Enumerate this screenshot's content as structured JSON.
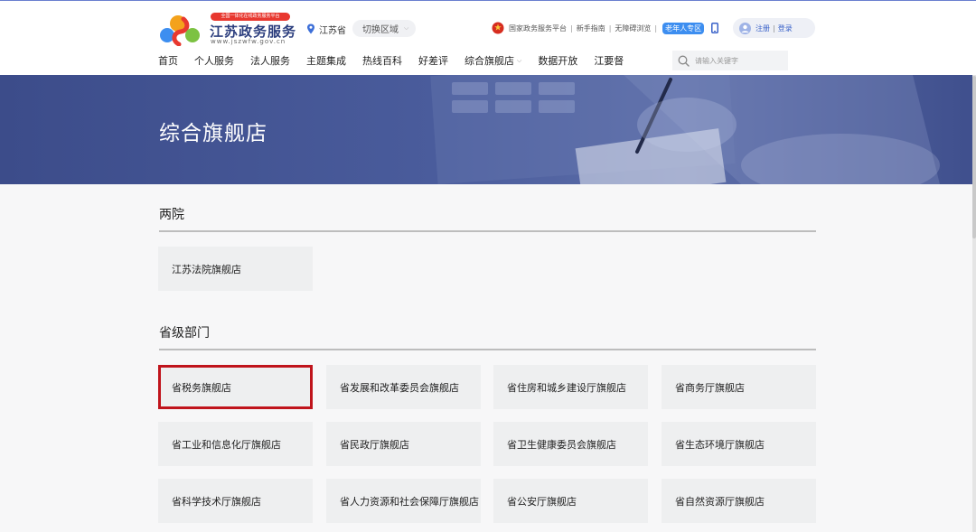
{
  "header": {
    "logo_badge": "全国一体化在线政务服务平台",
    "logo_title": "江苏政务服务",
    "logo_url": "www.jszwfw.gov.cn",
    "region": "江苏省",
    "switch_region": "切换区域",
    "links": [
      "国家政务服务平台",
      "新手指南",
      "无障碍浏览"
    ],
    "senior_zone": "老年人专区",
    "register": "注册",
    "login": "登录"
  },
  "nav": {
    "items": [
      "首页",
      "个人服务",
      "法人服务",
      "主题集成",
      "热线百科",
      "好差评",
      "综合旗舰店",
      "数据开放",
      "江要督"
    ],
    "search_placeholder": "请输入关键字"
  },
  "banner": {
    "title": "综合旗舰店"
  },
  "sections": [
    {
      "title": "两院",
      "items": [
        "江苏法院旗舰店"
      ]
    },
    {
      "title": "省级部门",
      "items": [
        "省税务旗舰店",
        "省发展和改革委员会旗舰店",
        "省住房和城乡建设厅旗舰店",
        "省商务厅旗舰店",
        "省工业和信息化厅旗舰店",
        "省民政厅旗舰店",
        "省卫生健康委员会旗舰店",
        "省生态环境厅旗舰店",
        "省科学技术厅旗舰店",
        "省人力资源和社会保障厅旗舰店",
        "省公安厅旗舰店",
        "省自然资源厅旗舰店"
      ]
    }
  ],
  "colors": {
    "brand_blue": "#2c3e7e",
    "banner": "#4a5c9c",
    "highlight": "#c0141c",
    "senior_badge": "#3d8ef0",
    "card_bg": "#eeeff0"
  },
  "icons": [
    "pin-icon",
    "chevron-down-icon",
    "national-emblem-icon",
    "phone-icon",
    "user-icon",
    "search-icon"
  ]
}
